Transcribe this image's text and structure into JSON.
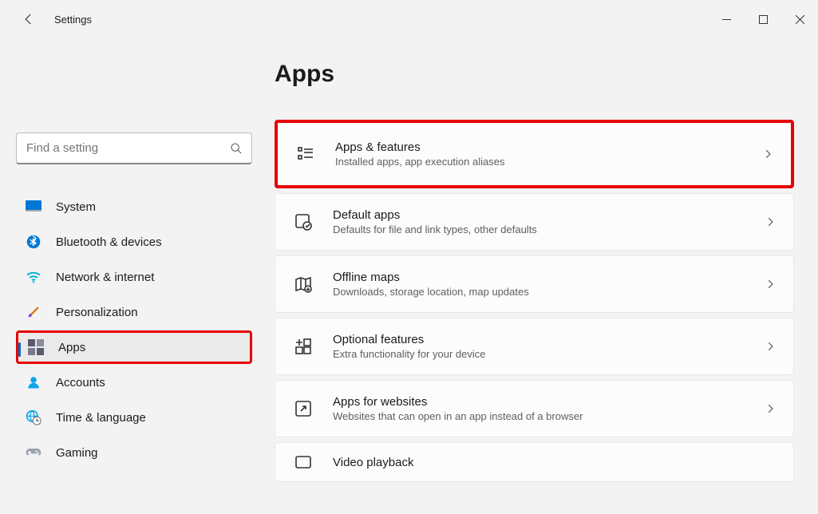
{
  "window": {
    "title": "Settings"
  },
  "search": {
    "placeholder": "Find a setting"
  },
  "sidebar": {
    "items": [
      {
        "label": "System"
      },
      {
        "label": "Bluetooth & devices"
      },
      {
        "label": "Network & internet"
      },
      {
        "label": "Personalization"
      },
      {
        "label": "Apps"
      },
      {
        "label": "Accounts"
      },
      {
        "label": "Time & language"
      },
      {
        "label": "Gaming"
      }
    ]
  },
  "page": {
    "title": "Apps"
  },
  "cards": [
    {
      "title": "Apps & features",
      "sub": "Installed apps, app execution aliases"
    },
    {
      "title": "Default apps",
      "sub": "Defaults for file and link types, other defaults"
    },
    {
      "title": "Offline maps",
      "sub": "Downloads, storage location, map updates"
    },
    {
      "title": "Optional features",
      "sub": "Extra functionality for your device"
    },
    {
      "title": "Apps for websites",
      "sub": "Websites that can open in an app instead of a browser"
    },
    {
      "title": "Video playback",
      "sub": ""
    }
  ]
}
